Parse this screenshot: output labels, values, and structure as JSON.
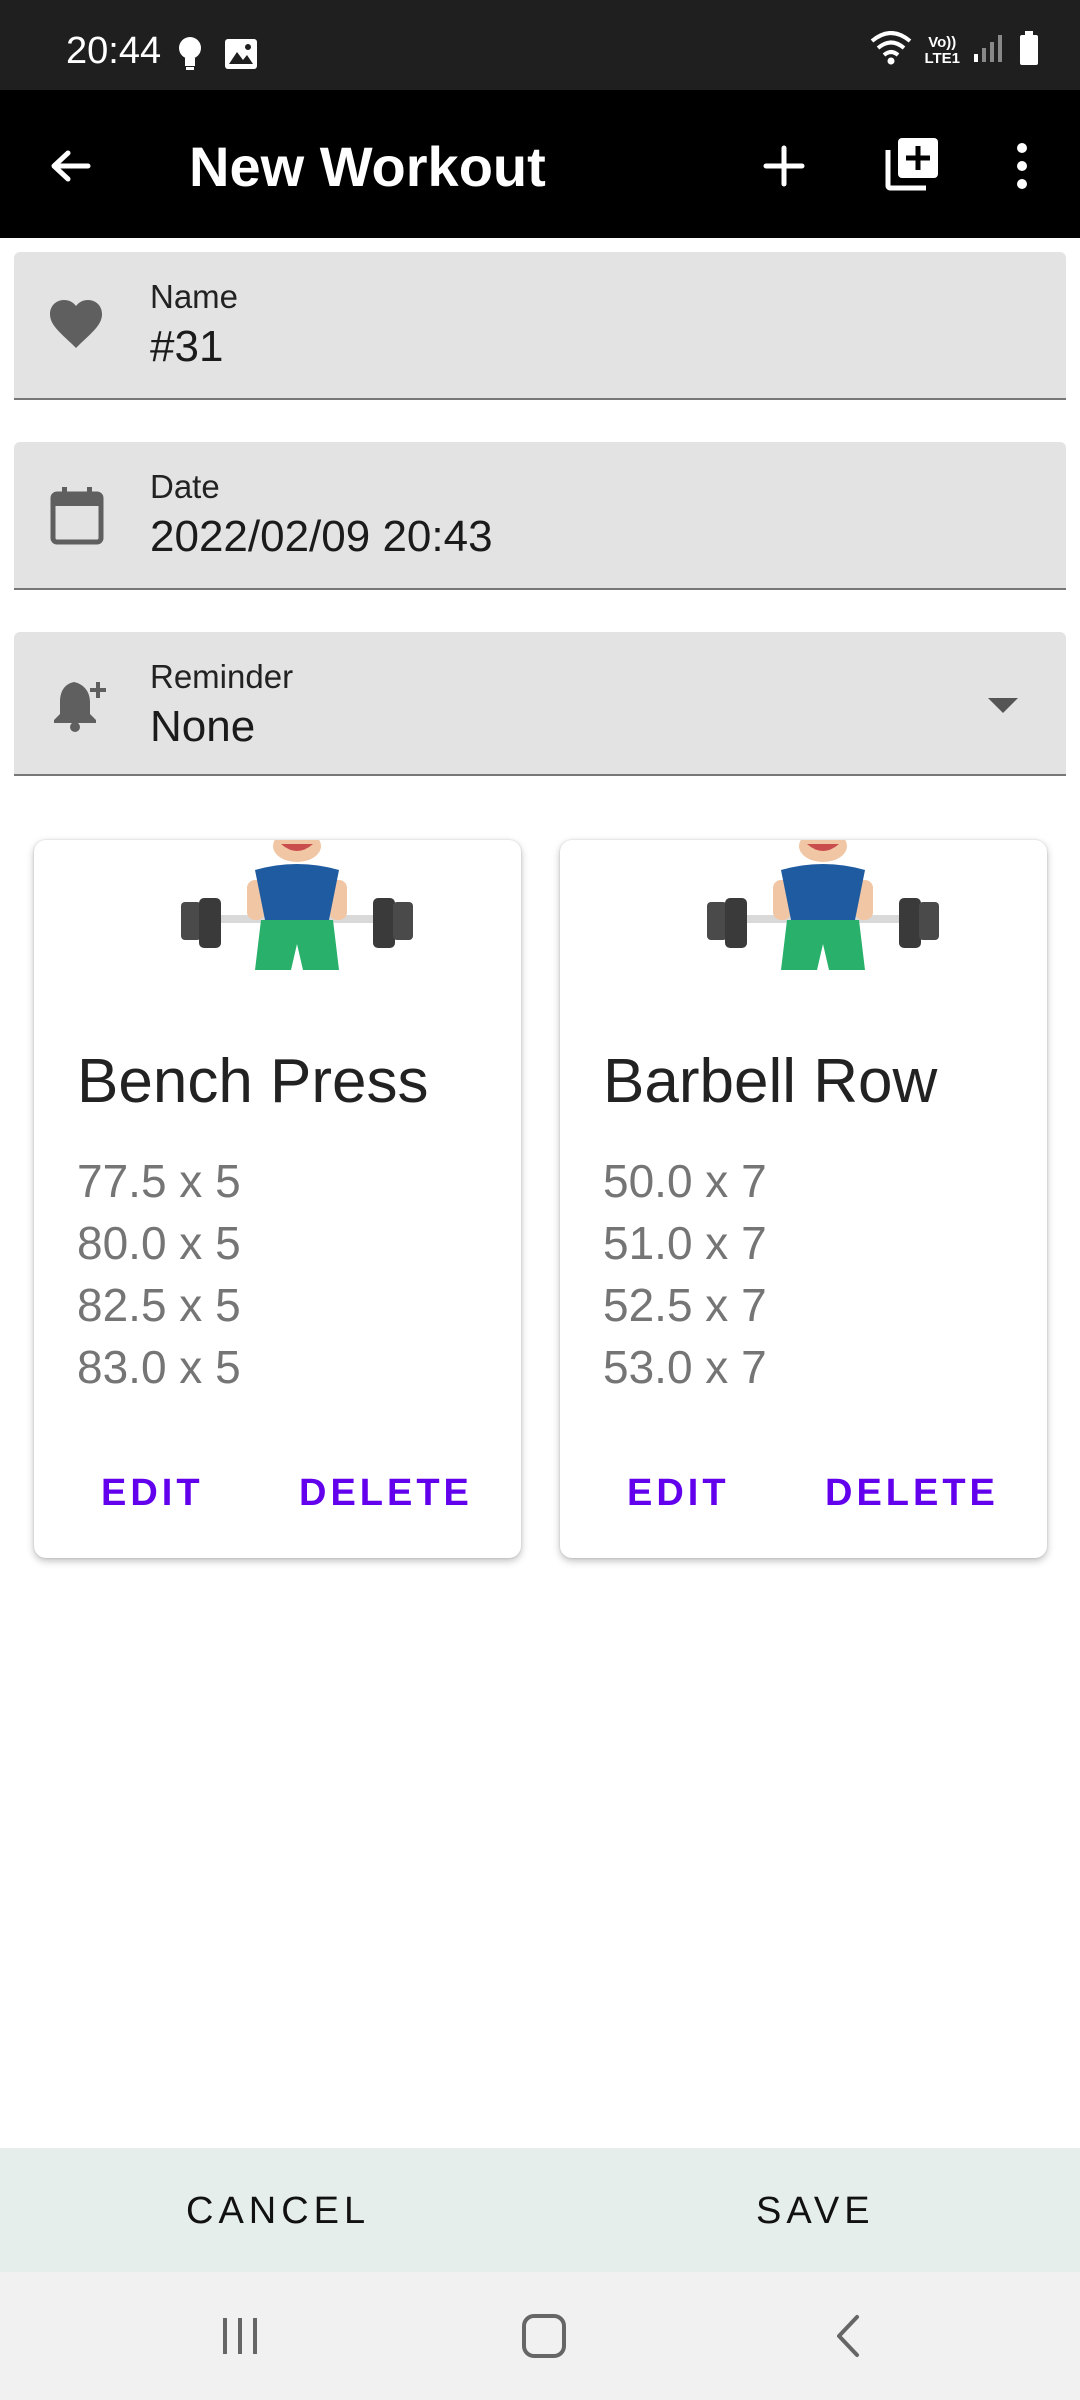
{
  "status_bar": {
    "time": "20:44",
    "network_top": "Vo))",
    "network_bottom": "LTE1",
    "icons": [
      "bulb-icon",
      "image-icon",
      "wifi-icon",
      "signal-icon",
      "battery-icon"
    ]
  },
  "app_bar": {
    "title": "New Workout",
    "icons": [
      "back-arrow-icon",
      "add-icon",
      "add-box-icon",
      "more-vert-icon"
    ]
  },
  "fields": {
    "name": {
      "label": "Name",
      "value": "#31",
      "icon": "heart-icon"
    },
    "date": {
      "label": "Date",
      "value": "2022/02/09 20:43",
      "icon": "calendar-icon"
    },
    "reminder": {
      "label": "Reminder",
      "value": "None",
      "icon": "bell-plus-icon"
    }
  },
  "exercises": [
    {
      "title": "Bench Press",
      "sets": [
        "77.5 x 5",
        "80.0 x 5",
        "82.5 x 5",
        "83.0 x 5"
      ],
      "edit_label": "EDIT",
      "delete_label": "DELETE"
    },
    {
      "title": "Barbell Row",
      "sets": [
        "50.0 x 7",
        "51.0 x 7",
        "52.5 x 7",
        "53.0 x 7"
      ],
      "edit_label": "EDIT",
      "delete_label": "DELETE"
    }
  ],
  "bottom_bar": {
    "cancel_label": "CANCEL",
    "save_label": "SAVE"
  },
  "colors": {
    "accent": "#6200ee",
    "app_bar": "#000000",
    "status_bar": "#1f1f1f",
    "field_bg": "#e3e3e3",
    "bottom_bar": "#e6eeec"
  }
}
